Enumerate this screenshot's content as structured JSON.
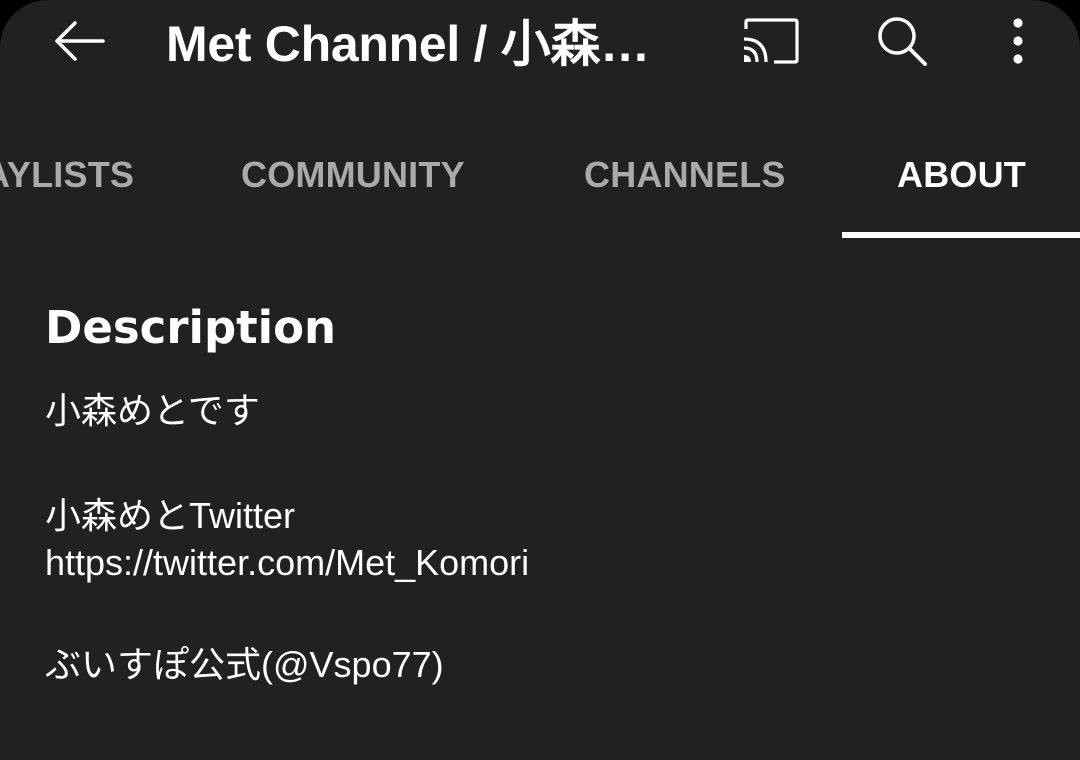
{
  "header": {
    "title": "Met Channel / 小森…",
    "back_icon": "arrow-back-icon",
    "cast_icon": "cast-icon",
    "search_icon": "search-icon",
    "more_icon": "more-vert-icon"
  },
  "tabs": [
    {
      "label": "AYLISTS",
      "selected": false
    },
    {
      "label": "COMMUNITY",
      "selected": false
    },
    {
      "label": "CHANNELS",
      "selected": false
    },
    {
      "label": "ABOUT",
      "selected": true
    }
  ],
  "about": {
    "heading": "Description",
    "lines": [
      "小森めとです",
      "小森めとTwitter",
      "https://twitter.com/Met_Komori",
      "ぶいすぽ公式(@Vspo77)"
    ]
  },
  "colors": {
    "background": "#212121",
    "text": "#ffffff",
    "tab_inactive": "#aaaaaa",
    "tab_indicator": "#ffffff"
  }
}
